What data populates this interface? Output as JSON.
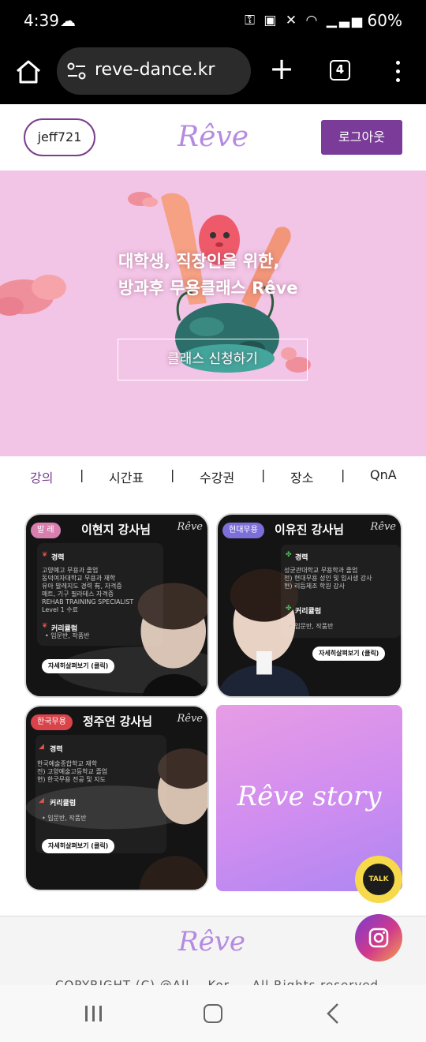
{
  "status_bar": {
    "time": "4:39",
    "battery": "60%"
  },
  "browser": {
    "url": "reve-dance.kr",
    "tab_count": "4"
  },
  "header": {
    "user_id": "jeff721",
    "logo": "Rêve",
    "logout_label": "로그아웃"
  },
  "hero": {
    "title_line1": "대학생, 직장인을 위한,",
    "title_line2": "방과후 무용클래스 Rêve",
    "cta_label": "클래스 신청하기"
  },
  "nav": {
    "items": [
      "강의",
      "시간표",
      "수강권",
      "장소",
      "QnA"
    ],
    "active": "강의"
  },
  "cards": [
    {
      "badge": "발 레",
      "badge_color": "#d87fb0",
      "teacher": "이현지 강사님",
      "mini_logo": "Rêve",
      "career_title": "경력",
      "career_text": "고양예고 무용과 졸업\n동덕여자대학교 무용과 재학\n유아 발레지도 경력 有, 자격증\n매트, 기구 필라테스 자격증\nREHAB TRAINING SPECIALIST\nLevel 1 수료",
      "curriculum_title": "커리큘럼",
      "curriculum_text": "• 입문반, 작품반",
      "cta": "자세히살펴보기 (클릭)"
    },
    {
      "badge": "현대무용",
      "badge_color": "#7d6fd9",
      "teacher": "이유진 강사님",
      "mini_logo": "Rêve",
      "career_title": "경력",
      "career_text": "성균관대학교 무용학과 졸업\n전) 현대무용 성인 및 입시생 강사\n현) 리듬체조 학원 강사",
      "curriculum_title": "커리큘럼",
      "curriculum_text": "• 입문반, 작품반",
      "cta": "자세히살펴보기 (클릭)"
    },
    {
      "badge": "한국무용",
      "badge_color": "#d9434a",
      "teacher": "정주연 강사님",
      "mini_logo": "Rêve",
      "career_title": "경력",
      "career_text": "한국예술종합학교 재학\n전) 고양예술고등학교 졸업\n현) 한국무용 전공 및 지도",
      "curriculum_title": "커리큘럼",
      "curriculum_text": "• 입문반, 작품반",
      "cta": "자세히살펴보기 (클릭)"
    }
  ],
  "story_card": {
    "label": "Rêve story"
  },
  "floating": {
    "talk_label": "TALK"
  },
  "footer": {
    "logo": "Rêve",
    "copyright": "COPYRIGHT (C) @All  ...Kor  ...  All Rights reserved"
  },
  "colors": {
    "brand_purple": "#7a3b99",
    "hero_pink": "#f2c4e6",
    "logo_lilac": "#b48be0"
  }
}
